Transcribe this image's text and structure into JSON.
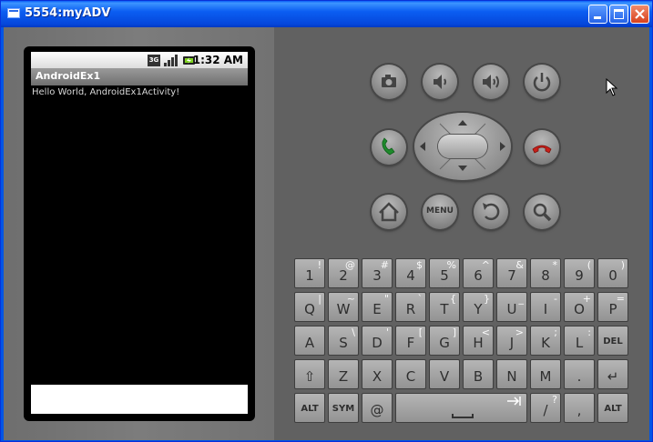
{
  "window": {
    "title": "5554:myADV"
  },
  "phone": {
    "status_bar": {
      "network_badge": "3G",
      "time": "1:32 AM"
    },
    "app_title": "AndroidEx1",
    "content_text": "Hello World, AndroidEx1Activity!"
  },
  "hardware_buttons": [
    {
      "name": "camera-button",
      "icon": "camera-icon"
    },
    {
      "name": "volume-down-button",
      "icon": "volume-down-icon"
    },
    {
      "name": "volume-up-button",
      "icon": "volume-up-icon"
    },
    {
      "name": "power-button",
      "icon": "power-icon"
    },
    {
      "name": "call-button",
      "icon": "phone-green-icon"
    },
    {
      "name": "end-call-button",
      "icon": "phone-red-icon"
    },
    {
      "name": "home-button",
      "icon": "home-icon"
    },
    {
      "name": "menu-button",
      "icon": "menu-text",
      "label": "MENU"
    },
    {
      "name": "back-button",
      "icon": "back-arrow-icon"
    },
    {
      "name": "search-button",
      "icon": "magnifier-icon"
    }
  ],
  "keyboard": {
    "rows": [
      [
        {
          "m": "1",
          "s": "!"
        },
        {
          "m": "2",
          "s": "@"
        },
        {
          "m": "3",
          "s": "#"
        },
        {
          "m": "4",
          "s": "$"
        },
        {
          "m": "5",
          "s": "%"
        },
        {
          "m": "6",
          "s": "^"
        },
        {
          "m": "7",
          "s": "&"
        },
        {
          "m": "8",
          "s": "*"
        },
        {
          "m": "9",
          "s": "("
        },
        {
          "m": "0",
          "s": ")"
        }
      ],
      [
        {
          "m": "Q",
          "s": "|"
        },
        {
          "m": "W",
          "s": "~"
        },
        {
          "m": "E",
          "s": "\""
        },
        {
          "m": "R",
          "s": "`"
        },
        {
          "m": "T",
          "s": "{"
        },
        {
          "m": "Y",
          "s": "}"
        },
        {
          "m": "U",
          "s": "_"
        },
        {
          "m": "I",
          "s": "-"
        },
        {
          "m": "O",
          "s": "+"
        },
        {
          "m": "P",
          "s": "="
        }
      ],
      [
        {
          "m": "A",
          "s": ""
        },
        {
          "m": "S",
          "s": "\\"
        },
        {
          "m": "D",
          "s": "'"
        },
        {
          "m": "F",
          "s": "["
        },
        {
          "m": "G",
          "s": "]"
        },
        {
          "m": "H",
          "s": "<"
        },
        {
          "m": "J",
          "s": ">"
        },
        {
          "m": "K",
          "s": ";"
        },
        {
          "m": "L",
          "s": ":"
        },
        {
          "m": "DEL",
          "s": ""
        }
      ],
      [
        {
          "m": "⇧",
          "s": ""
        },
        {
          "m": "Z",
          "s": ""
        },
        {
          "m": "X",
          "s": ""
        },
        {
          "m": "C",
          "s": ""
        },
        {
          "m": "V",
          "s": ""
        },
        {
          "m": "B",
          "s": ""
        },
        {
          "m": "N",
          "s": ""
        },
        {
          "m": "M",
          "s": ""
        },
        {
          "m": ".",
          "s": ""
        },
        {
          "m": "↵",
          "s": ""
        }
      ]
    ],
    "bottom": {
      "alt_left": "ALT",
      "sym": "SYM",
      "at": "@",
      "slash": "/",
      "slash_shift": "?",
      "comma": ",",
      "alt_right": "ALT"
    }
  }
}
